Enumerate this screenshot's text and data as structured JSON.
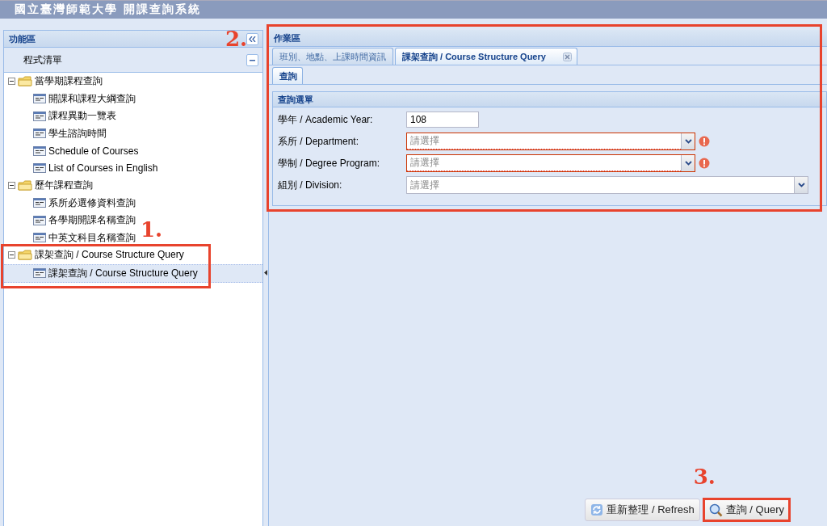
{
  "window": {
    "title": "國立臺灣師範大學 開課查詢系統"
  },
  "sidebar": {
    "title": "功能區",
    "list_title": "程式清單",
    "tree": [
      {
        "label": "當學期課程查詢",
        "expanded": true,
        "children": [
          {
            "label": "開課和課程大綱查詢",
            "selected": false
          },
          {
            "label": "課程異動一覽表",
            "selected": false
          },
          {
            "label": "學生諮詢時間",
            "selected": false
          },
          {
            "label": "Schedule of Courses",
            "selected": false
          },
          {
            "label": "List of Courses in English",
            "selected": false
          }
        ]
      },
      {
        "label": "歷年課程查詢",
        "expanded": true,
        "children": [
          {
            "label": "系所必選修資料查詢",
            "selected": false
          },
          {
            "label": "各學期開課名稱查詢",
            "selected": false
          },
          {
            "label": "中英文科目名稱查詢",
            "selected": false
          }
        ]
      },
      {
        "label": "課架查詢 / Course Structure Query",
        "expanded": true,
        "annotation": "1.",
        "children": [
          {
            "label": "課架查詢 / Course Structure Query",
            "selected": true
          }
        ]
      }
    ]
  },
  "work_area": {
    "title": "作業區",
    "annotation": "2.",
    "tabs": [
      {
        "label": "班別、地點、上課時間資訊",
        "selected": false,
        "closable": false
      },
      {
        "label": "課架查詢 / Course Structure Query",
        "selected": true,
        "closable": true
      }
    ],
    "sub_tabs": [
      {
        "label": "查詢",
        "selected": true
      }
    ],
    "form": {
      "title": "查詢選單",
      "fields": [
        {
          "label": "學年 / Academic Year:",
          "kind": "text",
          "value": "108",
          "invalid": false
        },
        {
          "label": "系所 / Department:",
          "kind": "select",
          "placeholder": "請選擇",
          "invalid": true
        },
        {
          "label": "學制 / Degree Program:",
          "kind": "select",
          "placeholder": "請選擇",
          "invalid": true
        },
        {
          "label": "組別 / Division:",
          "kind": "select",
          "placeholder": "請選擇",
          "invalid": false
        }
      ]
    },
    "buttons": [
      {
        "label": "重新整理 / Refresh",
        "kind": "refresh"
      },
      {
        "label": "查詢 / Query",
        "kind": "search",
        "annotation": "3."
      }
    ]
  }
}
